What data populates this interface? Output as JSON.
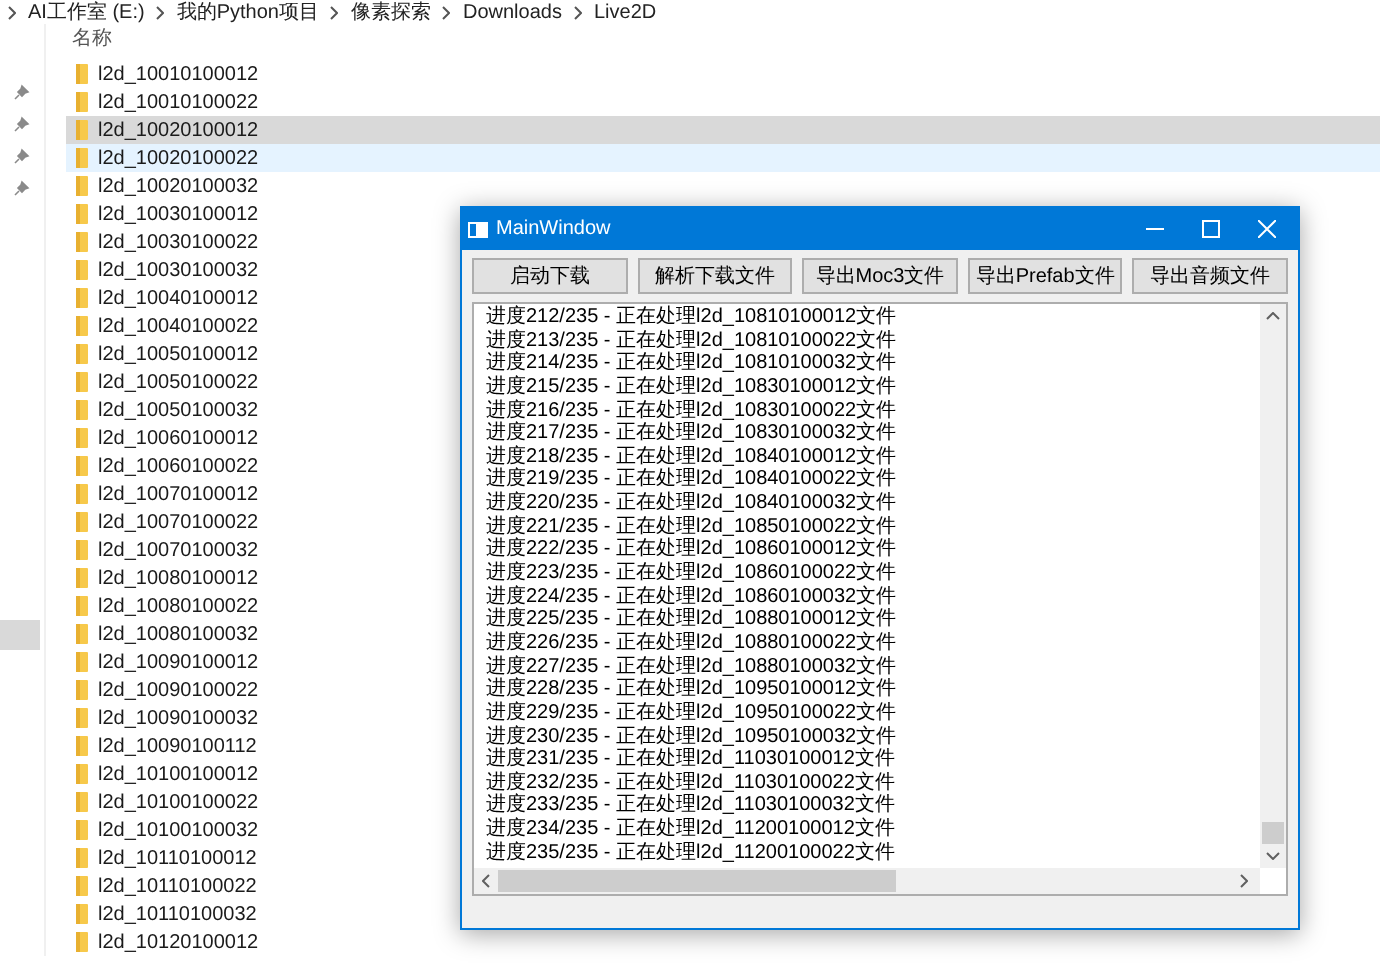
{
  "breadcrumb": [
    "AI工作室 (E:)",
    "我的Python项目",
    "像素探索",
    "Downloads",
    "Live2D"
  ],
  "column_header": "名称",
  "files": [
    {
      "name": "l2d_10010100012",
      "selected": false,
      "hovered": false
    },
    {
      "name": "l2d_10010100022",
      "selected": false,
      "hovered": false
    },
    {
      "name": "l2d_10020100012",
      "selected": true,
      "hovered": false
    },
    {
      "name": "l2d_10020100022",
      "selected": false,
      "hovered": true
    },
    {
      "name": "l2d_10020100032",
      "selected": false,
      "hovered": false
    },
    {
      "name": "l2d_10030100012",
      "selected": false,
      "hovered": false
    },
    {
      "name": "l2d_10030100022",
      "selected": false,
      "hovered": false
    },
    {
      "name": "l2d_10030100032",
      "selected": false,
      "hovered": false
    },
    {
      "name": "l2d_10040100012",
      "selected": false,
      "hovered": false
    },
    {
      "name": "l2d_10040100022",
      "selected": false,
      "hovered": false
    },
    {
      "name": "l2d_10050100012",
      "selected": false,
      "hovered": false
    },
    {
      "name": "l2d_10050100022",
      "selected": false,
      "hovered": false
    },
    {
      "name": "l2d_10050100032",
      "selected": false,
      "hovered": false
    },
    {
      "name": "l2d_10060100012",
      "selected": false,
      "hovered": false
    },
    {
      "name": "l2d_10060100022",
      "selected": false,
      "hovered": false
    },
    {
      "name": "l2d_10070100012",
      "selected": false,
      "hovered": false
    },
    {
      "name": "l2d_10070100022",
      "selected": false,
      "hovered": false
    },
    {
      "name": "l2d_10070100032",
      "selected": false,
      "hovered": false
    },
    {
      "name": "l2d_10080100012",
      "selected": false,
      "hovered": false
    },
    {
      "name": "l2d_10080100022",
      "selected": false,
      "hovered": false
    },
    {
      "name": "l2d_10080100032",
      "selected": false,
      "hovered": false
    },
    {
      "name": "l2d_10090100012",
      "selected": false,
      "hovered": false
    },
    {
      "name": "l2d_10090100022",
      "selected": false,
      "hovered": false
    },
    {
      "name": "l2d_10090100032",
      "selected": false,
      "hovered": false
    },
    {
      "name": "l2d_10090100112",
      "selected": false,
      "hovered": false
    },
    {
      "name": "l2d_10100100012",
      "selected": false,
      "hovered": false
    },
    {
      "name": "l2d_10100100022",
      "selected": false,
      "hovered": false
    },
    {
      "name": "l2d_10100100032",
      "selected": false,
      "hovered": false
    },
    {
      "name": "l2d_10110100012",
      "selected": false,
      "hovered": false
    },
    {
      "name": "l2d_10110100022",
      "selected": false,
      "hovered": false
    },
    {
      "name": "l2d_10110100032",
      "selected": false,
      "hovered": false
    },
    {
      "name": "l2d_10120100012",
      "selected": false,
      "hovered": false
    }
  ],
  "dialog": {
    "title": "MainWindow",
    "buttons": [
      "启动下载",
      "解析下载文件",
      "导出Moc3文件",
      "导出Prefab文件",
      "导出音频文件"
    ],
    "log": [
      "进度212/235 - 正在处理l2d_10810100012文件",
      "进度213/235 - 正在处理l2d_10810100022文件",
      "进度214/235 - 正在处理l2d_10810100032文件",
      "进度215/235 - 正在处理l2d_10830100012文件",
      "进度216/235 - 正在处理l2d_10830100022文件",
      "进度217/235 - 正在处理l2d_10830100032文件",
      "进度218/235 - 正在处理l2d_10840100012文件",
      "进度219/235 - 正在处理l2d_10840100022文件",
      "进度220/235 - 正在处理l2d_10840100032文件",
      "进度221/235 - 正在处理l2d_10850100022文件",
      "进度222/235 - 正在处理l2d_10860100012文件",
      "进度223/235 - 正在处理l2d_10860100022文件",
      "进度224/235 - 正在处理l2d_10860100032文件",
      "进度225/235 - 正在处理l2d_10880100012文件",
      "进度226/235 - 正在处理l2d_10880100022文件",
      "进度227/235 - 正在处理l2d_10880100032文件",
      "进度228/235 - 正在处理l2d_10950100012文件",
      "进度229/235 - 正在处理l2d_10950100022文件",
      "进度230/235 - 正在处理l2d_10950100032文件",
      "进度231/235 - 正在处理l2d_11030100012文件",
      "进度232/235 - 正在处理l2d_11030100022文件",
      "进度233/235 - 正在处理l2d_11030100032文件",
      "进度234/235 - 正在处理l2d_11200100012文件",
      "进度235/235 - 正在处理l2d_11200100022文件"
    ]
  }
}
